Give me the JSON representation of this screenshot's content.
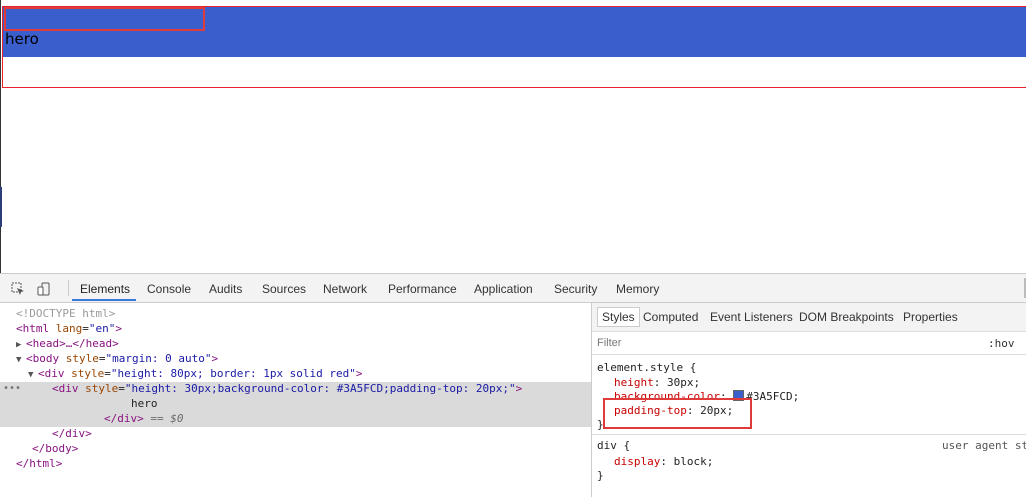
{
  "page": {
    "hero_text": "hero",
    "colors": {
      "hero_bg": "#3A5FCD",
      "outer_border": "red",
      "highlight": "#e03b3b"
    }
  },
  "devtools": {
    "tabs": [
      "Elements",
      "Console",
      "Audits",
      "Sources",
      "Network",
      "Performance",
      "Application",
      "Security",
      "Memory"
    ],
    "active_tab": "Elements",
    "icons": [
      "inspect-element-icon",
      "device-toolbar-icon"
    ],
    "dom": {
      "doctype": "<!DOCTYPE html>",
      "html_open_tag": "<html",
      "html_lang_attr": "lang",
      "html_lang_val": "\"en\"",
      "head_text": "<head>…</head>",
      "body_tag": "<body",
      "body_style_attr": "style",
      "body_style_val": "\"margin: 0 auto\"",
      "div_outer_tag": "<div",
      "div_outer_style_attr": "style",
      "div_outer_style_val": "\"height: 80px; border: 1px solid red\"",
      "div_inner_tag": "<div",
      "div_inner_style_attr": "style",
      "div_inner_style_val": "\"height: 30px;background-color: #3A5FCD;padding-top: 20px;\"",
      "inner_text": "hero",
      "div_inner_close": "</div>",
      "selected_marker": "== $0",
      "div_outer_close": "</div>",
      "body_close": "</body>",
      "html_close": "</html>"
    },
    "styles": {
      "subtabs": [
        "Styles",
        "Computed",
        "Event Listeners",
        "DOM Breakpoints",
        "Properties"
      ],
      "active_subtab": "Styles",
      "filter_placeholder": "Filter",
      "hov_label": ":hov",
      "element_style_selector": "element.style {",
      "rules": [
        {
          "prop": "height",
          "value": "30px;"
        },
        {
          "prop": "background-color",
          "value": "#3A5FCD;"
        },
        {
          "prop": "padding-top",
          "value": "20px;"
        }
      ],
      "close_brace": "}",
      "div_selector": "div {",
      "ua_label": "user agent st",
      "div_rule": {
        "prop": "display",
        "value": "block;"
      },
      "div_close_brace": "}"
    }
  }
}
